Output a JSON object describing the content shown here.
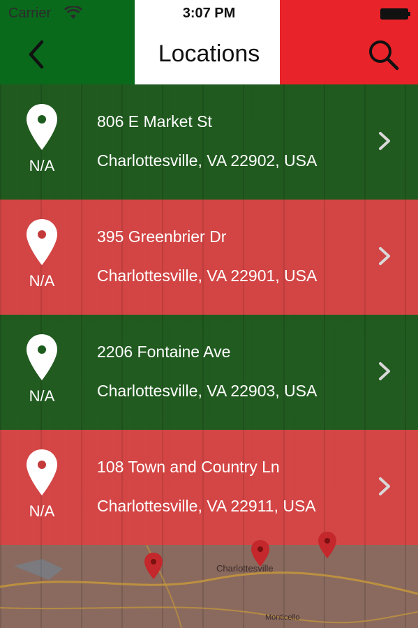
{
  "status_bar": {
    "carrier": "Carrier",
    "time": "3:07 PM"
  },
  "nav": {
    "title": "Locations",
    "back_icon": "chevron-left-icon",
    "search_icon": "search-icon"
  },
  "colors": {
    "green": "#0a6a1c",
    "white": "#ffffff",
    "red": "#e8242a"
  },
  "locations": [
    {
      "street": "806 E Market St",
      "city": "Charlottesville, VA 22902, USA",
      "distance": "N/A",
      "color": "green"
    },
    {
      "street": "395 Greenbrier Dr",
      "city": "Charlottesville, VA 22901, USA",
      "distance": "N/A",
      "color": "red"
    },
    {
      "street": "2206 Fontaine Ave",
      "city": "Charlottesville, VA 22903, USA",
      "distance": "N/A",
      "color": "green"
    },
    {
      "street": "108 Town and Country Ln",
      "city": "Charlottesville, VA 22911, USA",
      "distance": "N/A",
      "color": "red"
    }
  ],
  "map": {
    "city_label": "Charlottesville",
    "other_label": "Monticello"
  }
}
